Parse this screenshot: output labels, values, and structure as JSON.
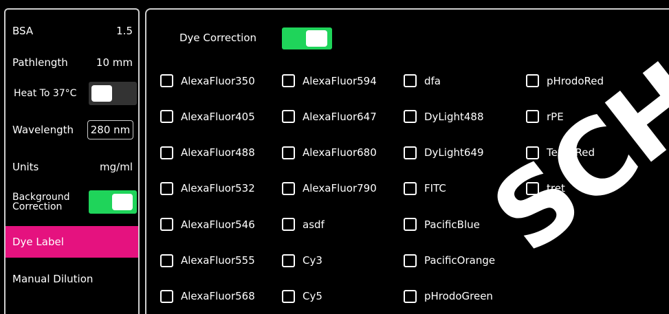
{
  "sidebar": {
    "bsa": {
      "label": "BSA",
      "value": "1.5"
    },
    "pathlength": {
      "label": "Pathlength",
      "value": "10 mm"
    },
    "heat": {
      "label": "Heat To 37°C",
      "state": "off"
    },
    "wavelength": {
      "label": "Wavelength",
      "value": "280 nm"
    },
    "units": {
      "label": "Units",
      "value": "mg/ml"
    },
    "background": {
      "label_line1": "Background",
      "label_line2": "Correction",
      "state": "on"
    },
    "dye_label": "Dye Label",
    "manual_dilution": "Manual Dilution"
  },
  "main": {
    "dye_correction_label": "Dye Correction",
    "dye_correction_state": "on",
    "columns": [
      [
        "AlexaFluor350",
        "AlexaFluor405",
        "AlexaFluor488",
        "AlexaFluor532",
        "AlexaFluor546",
        "AlexaFluor555",
        "AlexaFluor568"
      ],
      [
        "AlexaFluor594",
        "AlexaFluor647",
        "AlexaFluor680",
        "AlexaFluor790",
        "asdf",
        "Cy3",
        "Cy5"
      ],
      [
        "dfa",
        "DyLight488",
        "DyLight649",
        "FITC",
        "PacificBlue",
        "PacificOrange",
        "pHrodoGreen"
      ],
      [
        "pHrodoRed",
        "rPE",
        "TexasRed",
        "tret"
      ]
    ]
  },
  "colors": {
    "accent_pink": "#e5127f",
    "toggle_green": "#1fd45a"
  }
}
